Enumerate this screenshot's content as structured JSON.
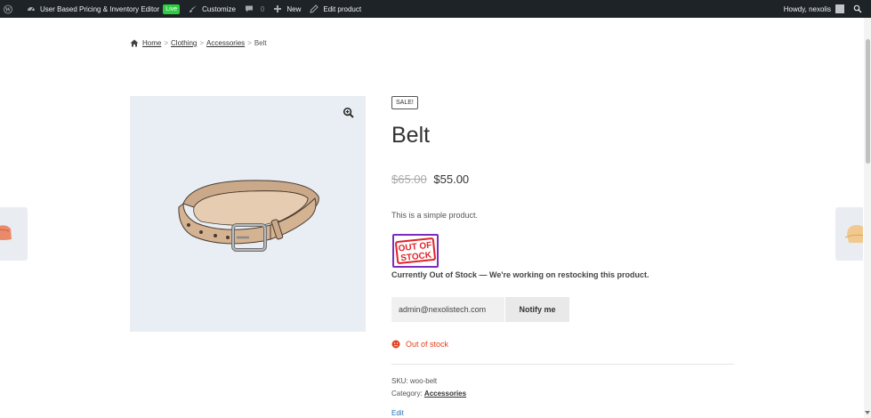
{
  "admin_bar": {
    "site_name": "User Based Pricing & Inventory Editor",
    "live_badge": "Live",
    "customize": "Customize",
    "comments_count": "0",
    "new": "New",
    "edit_product": "Edit product",
    "howdy": "Howdy, nexolis"
  },
  "breadcrumb": {
    "home": "Home",
    "clothing": "Clothing",
    "accessories": "Accessories",
    "current": "Belt",
    "separator": ">"
  },
  "product": {
    "sale_badge": "SALE!",
    "title": "Belt",
    "regular_price": "$65.00",
    "sale_price": "$55.00",
    "short_description": "This is a simple product.",
    "oos_badge_text": "OUT OF STOCK",
    "oos_message": "Currently Out of Stock — We're working on restocking this product.",
    "notify_email_value": "admin@nexolistech.com",
    "notify_button": "Notify me",
    "stock_status": "Out of stock",
    "sku_label": "SKU:",
    "sku_value": "woo-belt",
    "category_label": "Category:",
    "category_value": "Accessories",
    "edit_link": "Edit"
  },
  "colors": {
    "admin_bar_bg": "#1d2327",
    "live_badge": "#2ecc40",
    "gallery_bg": "#e8eef3",
    "out_of_stock_red": "#e2401c",
    "oos_badge_border": "#7b2cbf",
    "edit_link": "#2271b1"
  }
}
